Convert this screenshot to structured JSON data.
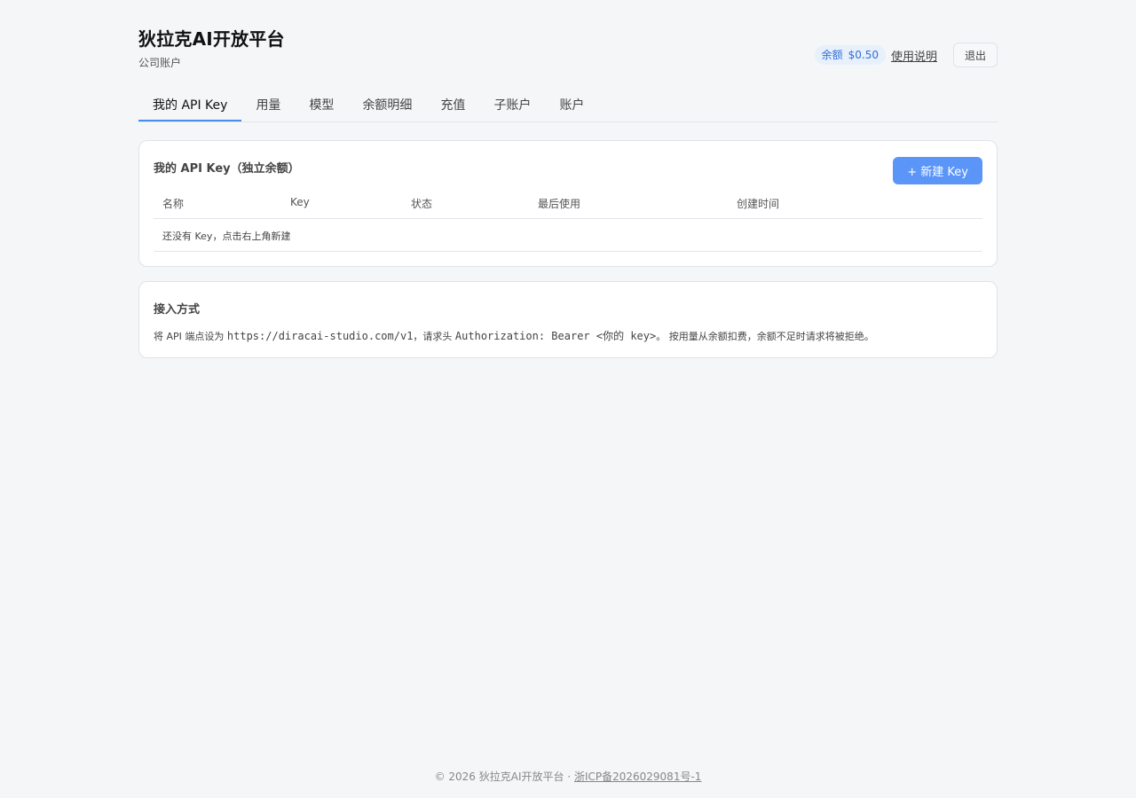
{
  "header": {
    "title": "狄拉克AI开放平台",
    "subtitle": "公司账户",
    "balance_label": "余额",
    "balance_value": "$0.50",
    "help_label": "使用说明",
    "logout_label": "退出"
  },
  "tabs": [
    {
      "label": "我的 API Key",
      "active": true
    },
    {
      "label": "用量"
    },
    {
      "label": "模型"
    },
    {
      "label": "余额明细"
    },
    {
      "label": "充值"
    },
    {
      "label": "子账户"
    },
    {
      "label": "账户"
    }
  ],
  "keys_card": {
    "title": "我的 API Key（独立余额）",
    "new_key_label": "+ 新建 Key",
    "columns": [
      "名称",
      "Key",
      "状态",
      "最后使用",
      "创建时间"
    ],
    "empty_text": "还没有 Key，点击右上角新建"
  },
  "access_card": {
    "title": "接入方式",
    "text_1": "将 API 端点设为 ",
    "endpoint": "https://diracai-studio.com/v1",
    "text_2": "，请求头 ",
    "header_code": "Authorization: Bearer <你的 key>",
    "text_3": "。 按用量从余额扣费，余额不足时请求将被拒绝。"
  },
  "footer": {
    "copyright": "© 2026 狄拉克AI开放平台 · ",
    "icp": "浙ICP备2026029081号-1"
  },
  "colors": {
    "accent": "#4a8bee",
    "button": "#5b95f8",
    "badge_bg": "#e8f0fc",
    "badge_text": "#2f6fd6",
    "background": "#f4f6f8"
  }
}
